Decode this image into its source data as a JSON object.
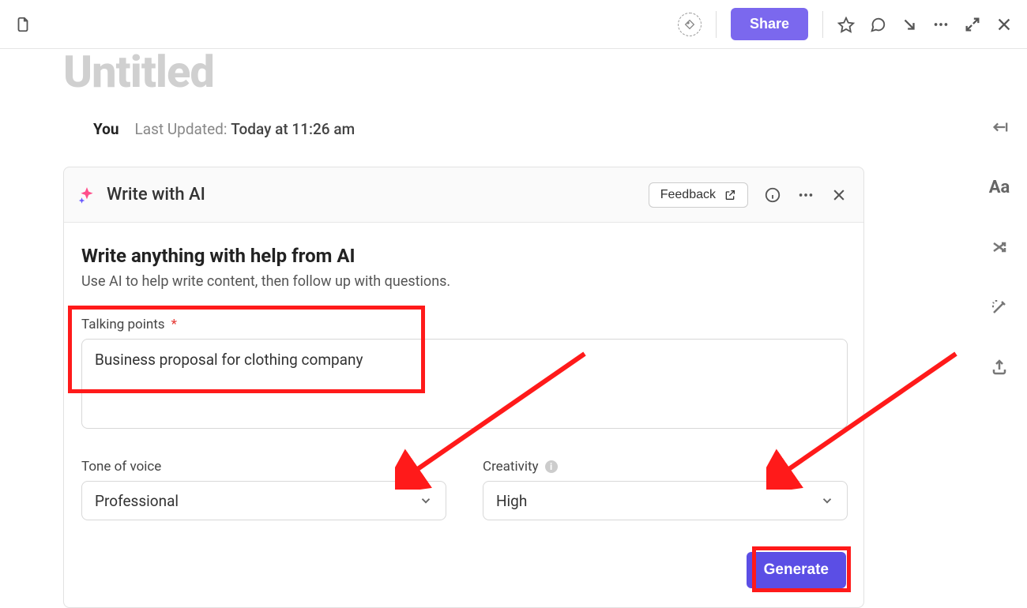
{
  "topbar": {
    "share_label": "Share"
  },
  "document": {
    "title": "Untitled",
    "author": "You",
    "last_updated_label": "Last Updated:",
    "last_updated_value": "Today at 11:26 am"
  },
  "ai_panel": {
    "title": "Write with AI",
    "feedback_label": "Feedback",
    "heading": "Write anything with help from AI",
    "subheading": "Use AI to help write content, then follow up with questions.",
    "talking_points": {
      "label": "Talking points",
      "required_marker": "*",
      "value": "Business proposal for clothing company"
    },
    "tone": {
      "label": "Tone of voice",
      "value": "Professional"
    },
    "creativity": {
      "label": "Creativity",
      "value": "High"
    },
    "generate_label": "Generate"
  },
  "annotations": {
    "arrow_color": "#ff1a1a"
  }
}
